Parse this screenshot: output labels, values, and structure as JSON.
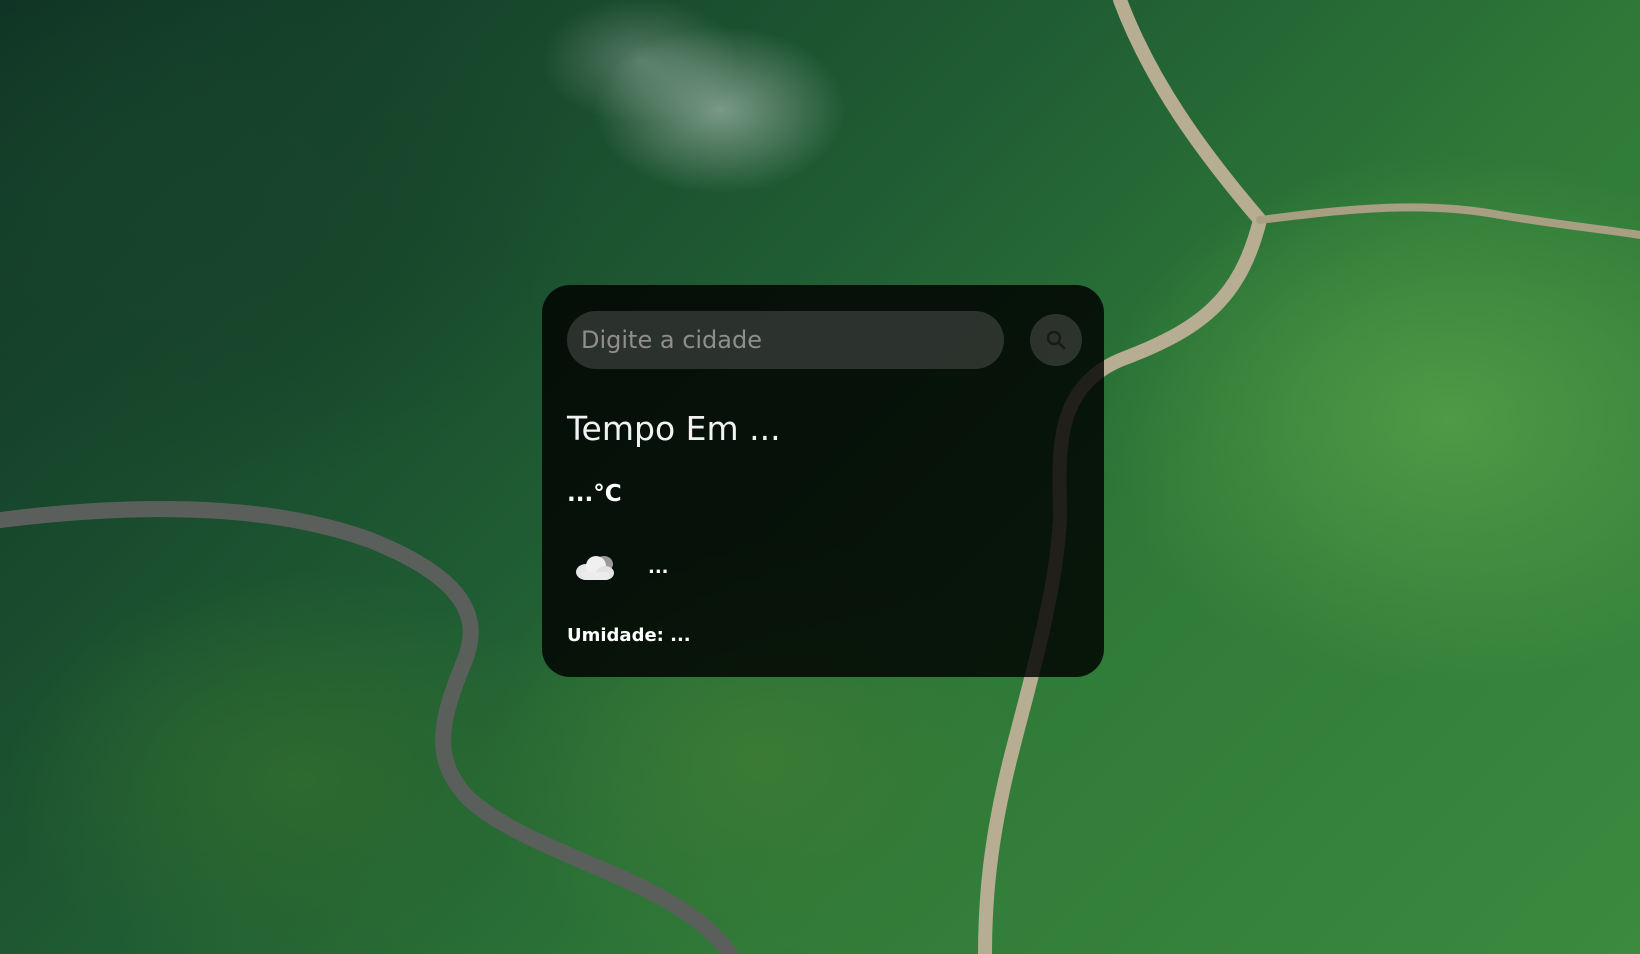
{
  "search": {
    "placeholder": "Digite a cidade",
    "value": ""
  },
  "weather": {
    "title": "Tempo Em ...",
    "temperature": "...°C",
    "icon": "cloud-icon",
    "description": "...",
    "humidity": "Umidade: ..."
  }
}
